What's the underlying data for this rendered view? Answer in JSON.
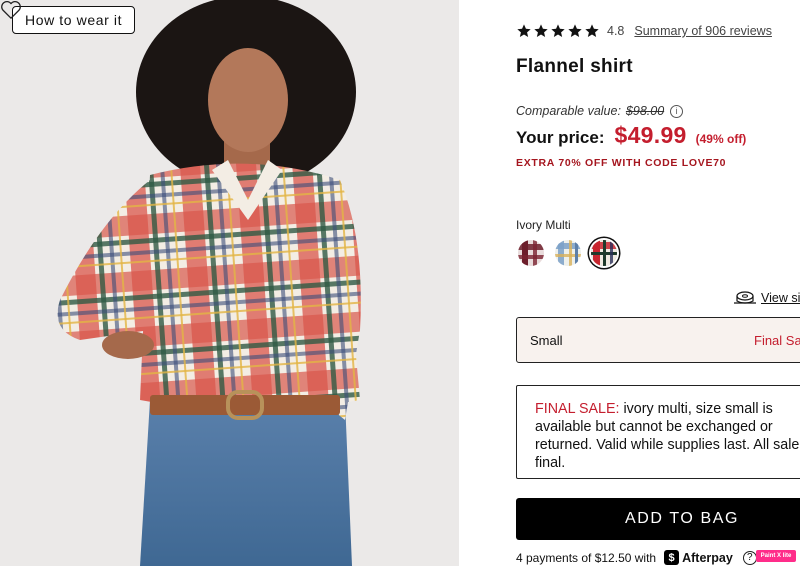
{
  "gallery": {
    "how_to_wear_label": "How to wear it",
    "favorite_icon": "heart-outline-icon"
  },
  "product": {
    "rating": "4.8",
    "rating_stars": 5,
    "reviews_link": "Summary of 906 reviews",
    "title": "Flannel shirt",
    "comparable_label": "Comparable value:",
    "comparable_price": "$98.00",
    "your_price_label": "Your price:",
    "price": "$49.99",
    "discount": "(49% off)",
    "promo": "EXTRA 70% OFF WITH CODE LOVE70",
    "color_name": "Ivory Multi",
    "swatches": [
      {
        "name": "swatch-burgundy-plaid",
        "selected": false
      },
      {
        "name": "swatch-blue-plaid",
        "selected": false
      },
      {
        "name": "swatch-ivory-multi",
        "selected": true
      }
    ]
  },
  "size": {
    "guide_label": "View siz",
    "selected_size": "Small",
    "status": "Final Sale"
  },
  "final_sale": {
    "prefix": "FINAL SALE:",
    "message": " ivory multi, size small is available but cannot be exchanged or returned. Valid while supplies last. All sale final."
  },
  "cart": {
    "add_label": "ADD TO BAG"
  },
  "afterpay": {
    "text": "4 payments of $12.50 with",
    "brand": "Afterpay",
    "help": "?"
  },
  "extension_badge": "Paint X lite",
  "colors": {
    "sale_red": "#c41e2e",
    "promo_red": "#a5161f",
    "size_box_bg": "#f8f2ee",
    "button_black": "#000000"
  }
}
